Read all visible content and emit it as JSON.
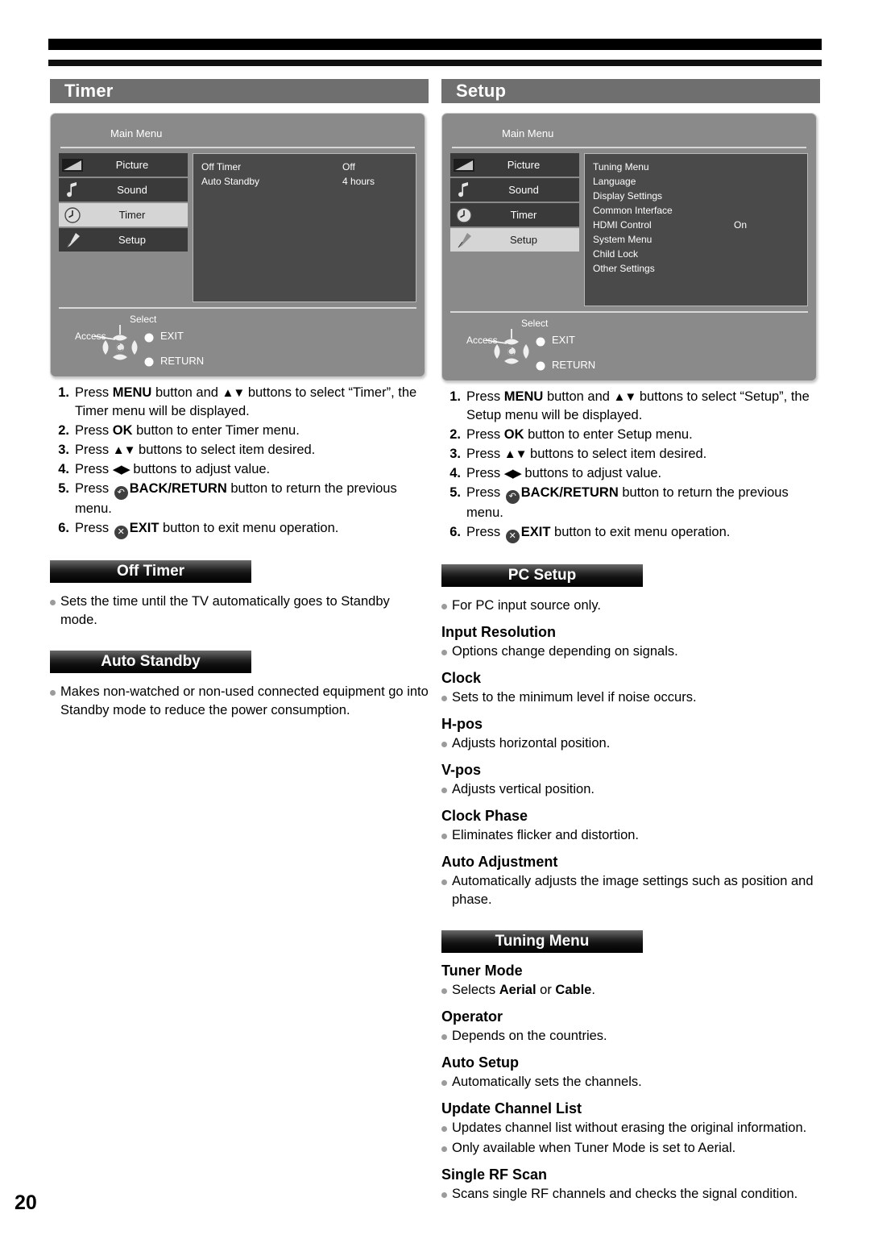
{
  "page": {
    "number": "20"
  },
  "left": {
    "section_title": "Timer",
    "osd": {
      "title": "Main Menu",
      "menu_items": [
        {
          "label": "Picture",
          "icon": "picture-icon",
          "selected": false
        },
        {
          "label": "Sound",
          "icon": "music-note-icon",
          "selected": false
        },
        {
          "label": "Timer",
          "icon": "clock-icon",
          "selected": true
        },
        {
          "label": "Setup",
          "icon": "wrench-icon",
          "selected": false
        }
      ],
      "rows": [
        {
          "key": "Off Timer",
          "value": "Off"
        },
        {
          "key": "Auto Standby",
          "value": "4 hours"
        }
      ],
      "nav": {
        "select": "Select",
        "access": "Access",
        "exit": "EXIT",
        "return": "RETURN"
      }
    },
    "steps": [
      {
        "num": "1.",
        "pre": "Press ",
        "bold1": "MENU",
        "mid1": " button and ",
        "arrows": "▲▼",
        "mid2": " buttons to select “Timer”, the Timer menu will be displayed."
      },
      {
        "num": "2.",
        "pre": "Press ",
        "bold1": "OK",
        "mid1": " button to enter Timer menu.",
        "arrows": "",
        "mid2": ""
      },
      {
        "num": "3.",
        "pre": "Press ",
        "bold1": "",
        "mid1": "",
        "arrows": "▲▼",
        "mid2": " buttons to select item desired."
      },
      {
        "num": "4.",
        "pre": "Press ",
        "bold1": "",
        "mid1": "",
        "arrows": "◀▶",
        "mid2": " buttons to adjust value."
      },
      {
        "num": "5.",
        "pre": "Press ",
        "glyph": "↶",
        "bold1": "BACK/RETURN",
        "mid2": " button to return the previous menu."
      },
      {
        "num": "6.",
        "pre": "Press ",
        "glyph": "✕",
        "bold1": "EXIT",
        "mid2": " button to exit menu operation."
      }
    ],
    "subsections": [
      {
        "title": "Off Timer",
        "bullets": [
          "Sets the time until the TV automatically goes to Standby mode."
        ]
      },
      {
        "title": "Auto Standby",
        "bullets": [
          "Makes non-watched or non-used connected equipment go into Standby mode to reduce the power consumption."
        ]
      }
    ]
  },
  "right": {
    "section_title": "Setup",
    "osd": {
      "title": "Main Menu",
      "menu_items": [
        {
          "label": "Picture",
          "icon": "picture-icon",
          "selected": false
        },
        {
          "label": "Sound",
          "icon": "music-note-icon",
          "selected": false
        },
        {
          "label": "Timer",
          "icon": "clock-icon",
          "selected": false
        },
        {
          "label": "Setup",
          "icon": "wrench-icon",
          "selected": true
        }
      ],
      "rows": [
        {
          "key": "Tuning Menu",
          "value": ""
        },
        {
          "key": "Language",
          "value": ""
        },
        {
          "key": "Display Settings",
          "value": ""
        },
        {
          "key": "Common Interface",
          "value": ""
        },
        {
          "key": "HDMI Control",
          "value": "On"
        },
        {
          "key": "System Menu",
          "value": ""
        },
        {
          "key": "Child Lock",
          "value": ""
        },
        {
          "key": "Other Settings",
          "value": ""
        }
      ],
      "nav": {
        "select": "Select",
        "access": "Access",
        "exit": "EXIT",
        "return": "RETURN"
      }
    },
    "steps": [
      {
        "num": "1.",
        "pre": "Press ",
        "bold1": "MENU",
        "mid1": " button and ",
        "arrows": "▲▼",
        "mid2": " buttons to select “Setup”, the Setup menu will be displayed."
      },
      {
        "num": "2.",
        "pre": "Press ",
        "bold1": "OK",
        "mid1": " button to enter Setup menu.",
        "arrows": "",
        "mid2": ""
      },
      {
        "num": "3.",
        "pre": "Press ",
        "bold1": "",
        "mid1": "",
        "arrows": "▲▼",
        "mid2": " buttons to select item desired."
      },
      {
        "num": "4.",
        "pre": "Press ",
        "bold1": "",
        "mid1": "",
        "arrows": "◀▶",
        "mid2": " buttons to adjust value."
      },
      {
        "num": "5.",
        "pre": "Press ",
        "glyph": "↶",
        "bold1": "BACK/RETURN",
        "mid2": " button to return the previous menu."
      },
      {
        "num": "6.",
        "pre": "Press ",
        "glyph": "✕",
        "bold1": "EXIT",
        "mid2": " button to exit menu operation."
      }
    ],
    "pc_setup": {
      "title": "PC Setup",
      "lead_bullet": "For PC input source only.",
      "items": [
        {
          "title": "Input Resolution",
          "bullets": [
            "Options change depending on signals."
          ]
        },
        {
          "title": "Clock",
          "bullets": [
            "Sets to the minimum level if noise occurs."
          ]
        },
        {
          "title": "H-pos",
          "bullets": [
            "Adjusts horizontal position."
          ]
        },
        {
          "title": "V-pos",
          "bullets": [
            "Adjusts vertical position."
          ]
        },
        {
          "title": "Clock Phase",
          "bullets": [
            "Eliminates flicker and distortion."
          ]
        },
        {
          "title": "Auto Adjustment",
          "bullets": [
            "Automatically adjusts the image settings such as position and phase."
          ]
        }
      ]
    },
    "tuning_menu": {
      "title": "Tuning Menu",
      "items": [
        {
          "title": "Tuner Mode",
          "bullets_html": [
            "Selects <b>Aerial</b> or <b>Cable</b>."
          ]
        },
        {
          "title": "Operator",
          "bullets_html": [
            "Depends on the countries."
          ]
        },
        {
          "title": "Auto Setup",
          "bullets_html": [
            "Automatically sets the channels."
          ]
        },
        {
          "title": "Update Channel List",
          "bullets_html": [
            "Updates channel list without erasing the original information.",
            "Only available when Tuner Mode is set to Aerial."
          ]
        },
        {
          "title": "Single RF Scan",
          "bullets_html": [
            "Scans single RF channels and checks the signal condition."
          ]
        }
      ]
    }
  }
}
